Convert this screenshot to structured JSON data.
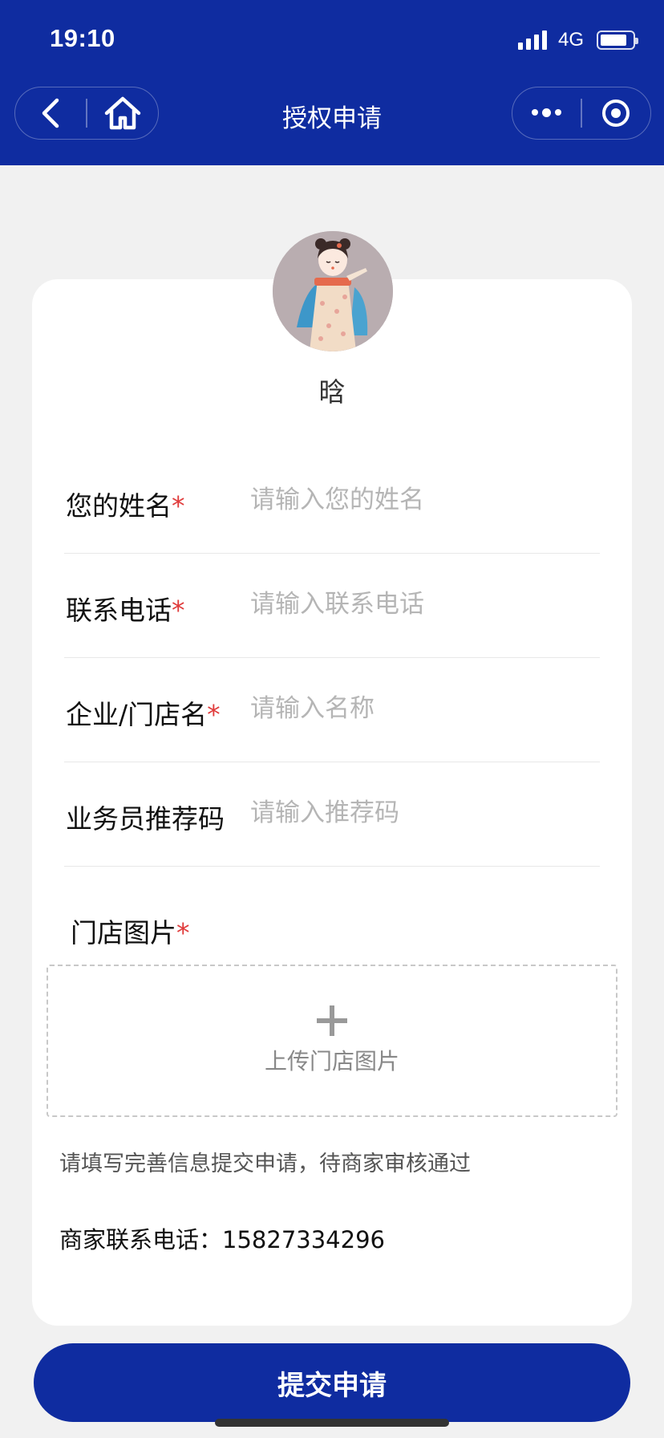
{
  "status_bar": {
    "time": "19:10",
    "network": "4G",
    "battery_level": 0.85
  },
  "nav": {
    "title": "授权申请",
    "back_icon": "chevron-left-icon",
    "home_icon": "home-icon",
    "more_icon": "more-dots-icon",
    "close_icon": "target-close-icon"
  },
  "profile": {
    "nickname": "晗"
  },
  "form": {
    "name": {
      "label": "您的姓名",
      "required_mark": "*",
      "placeholder": "请输入您的姓名",
      "value": ""
    },
    "phone": {
      "label": "联系电话",
      "required_mark": "*",
      "placeholder": "请输入联系电话",
      "value": ""
    },
    "store": {
      "label": "企业/门店名",
      "required_mark": "*",
      "placeholder": "请输入名称",
      "value": ""
    },
    "referral": {
      "label": "业务员推荐码",
      "placeholder": "请输入推荐码",
      "value": ""
    },
    "photo": {
      "label": "门店图片",
      "required_mark": "*",
      "upload_text": "上传门店图片"
    }
  },
  "notice": "请填写完善信息提交申请，待商家审核通过",
  "merchant": {
    "label": "商家联系电话：",
    "phone": "15827334296"
  },
  "submit_label": "提交申请",
  "colors": {
    "primary": "#0f2ca0",
    "required": "#e03b3b",
    "background": "#f1f1f1"
  }
}
